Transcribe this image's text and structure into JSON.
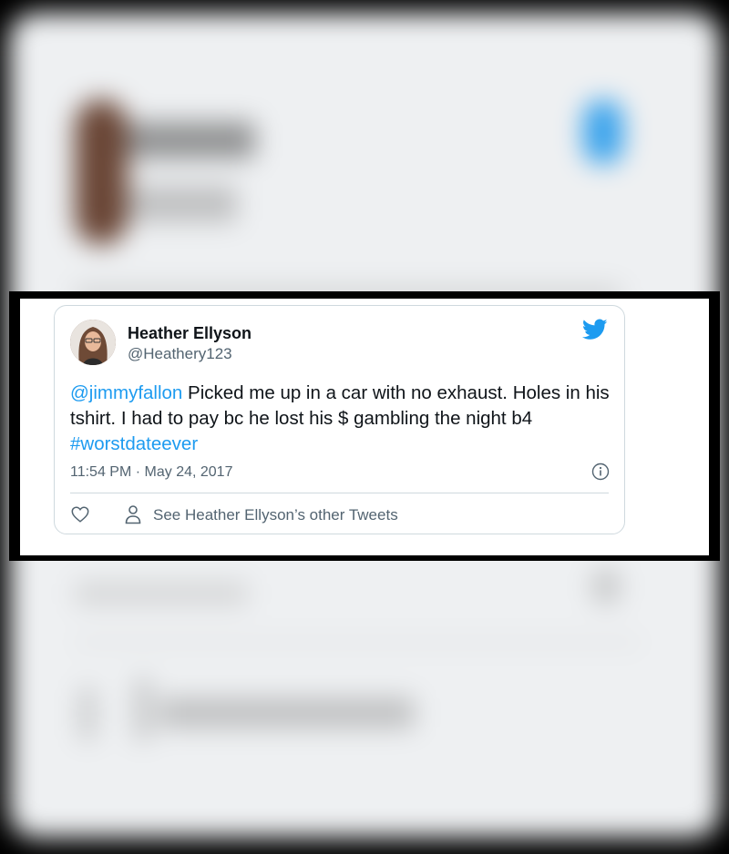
{
  "tweet": {
    "author_name": "Heather Ellyson",
    "author_handle": "@Heathery123",
    "mention": "@jimmyfallon",
    "body_text": " Picked me up in a car with no exhaust. Holes in his tshirt. I had to pay bc he lost his $ gambling the night b4 ",
    "hashtag": "#worstdateever",
    "timestamp": "11:54 PM · May 24, 2017",
    "see_other_tweets": "See Heather Ellyson’s other Tweets"
  },
  "icons": {
    "logo": "twitter-bird-icon",
    "info": "info-icon",
    "like": "heart-icon",
    "profile": "person-icon"
  },
  "colors": {
    "accent": "#1d9bf0",
    "text": "#0f1419",
    "secondary_text": "#536471",
    "border": "#cfd9de"
  }
}
